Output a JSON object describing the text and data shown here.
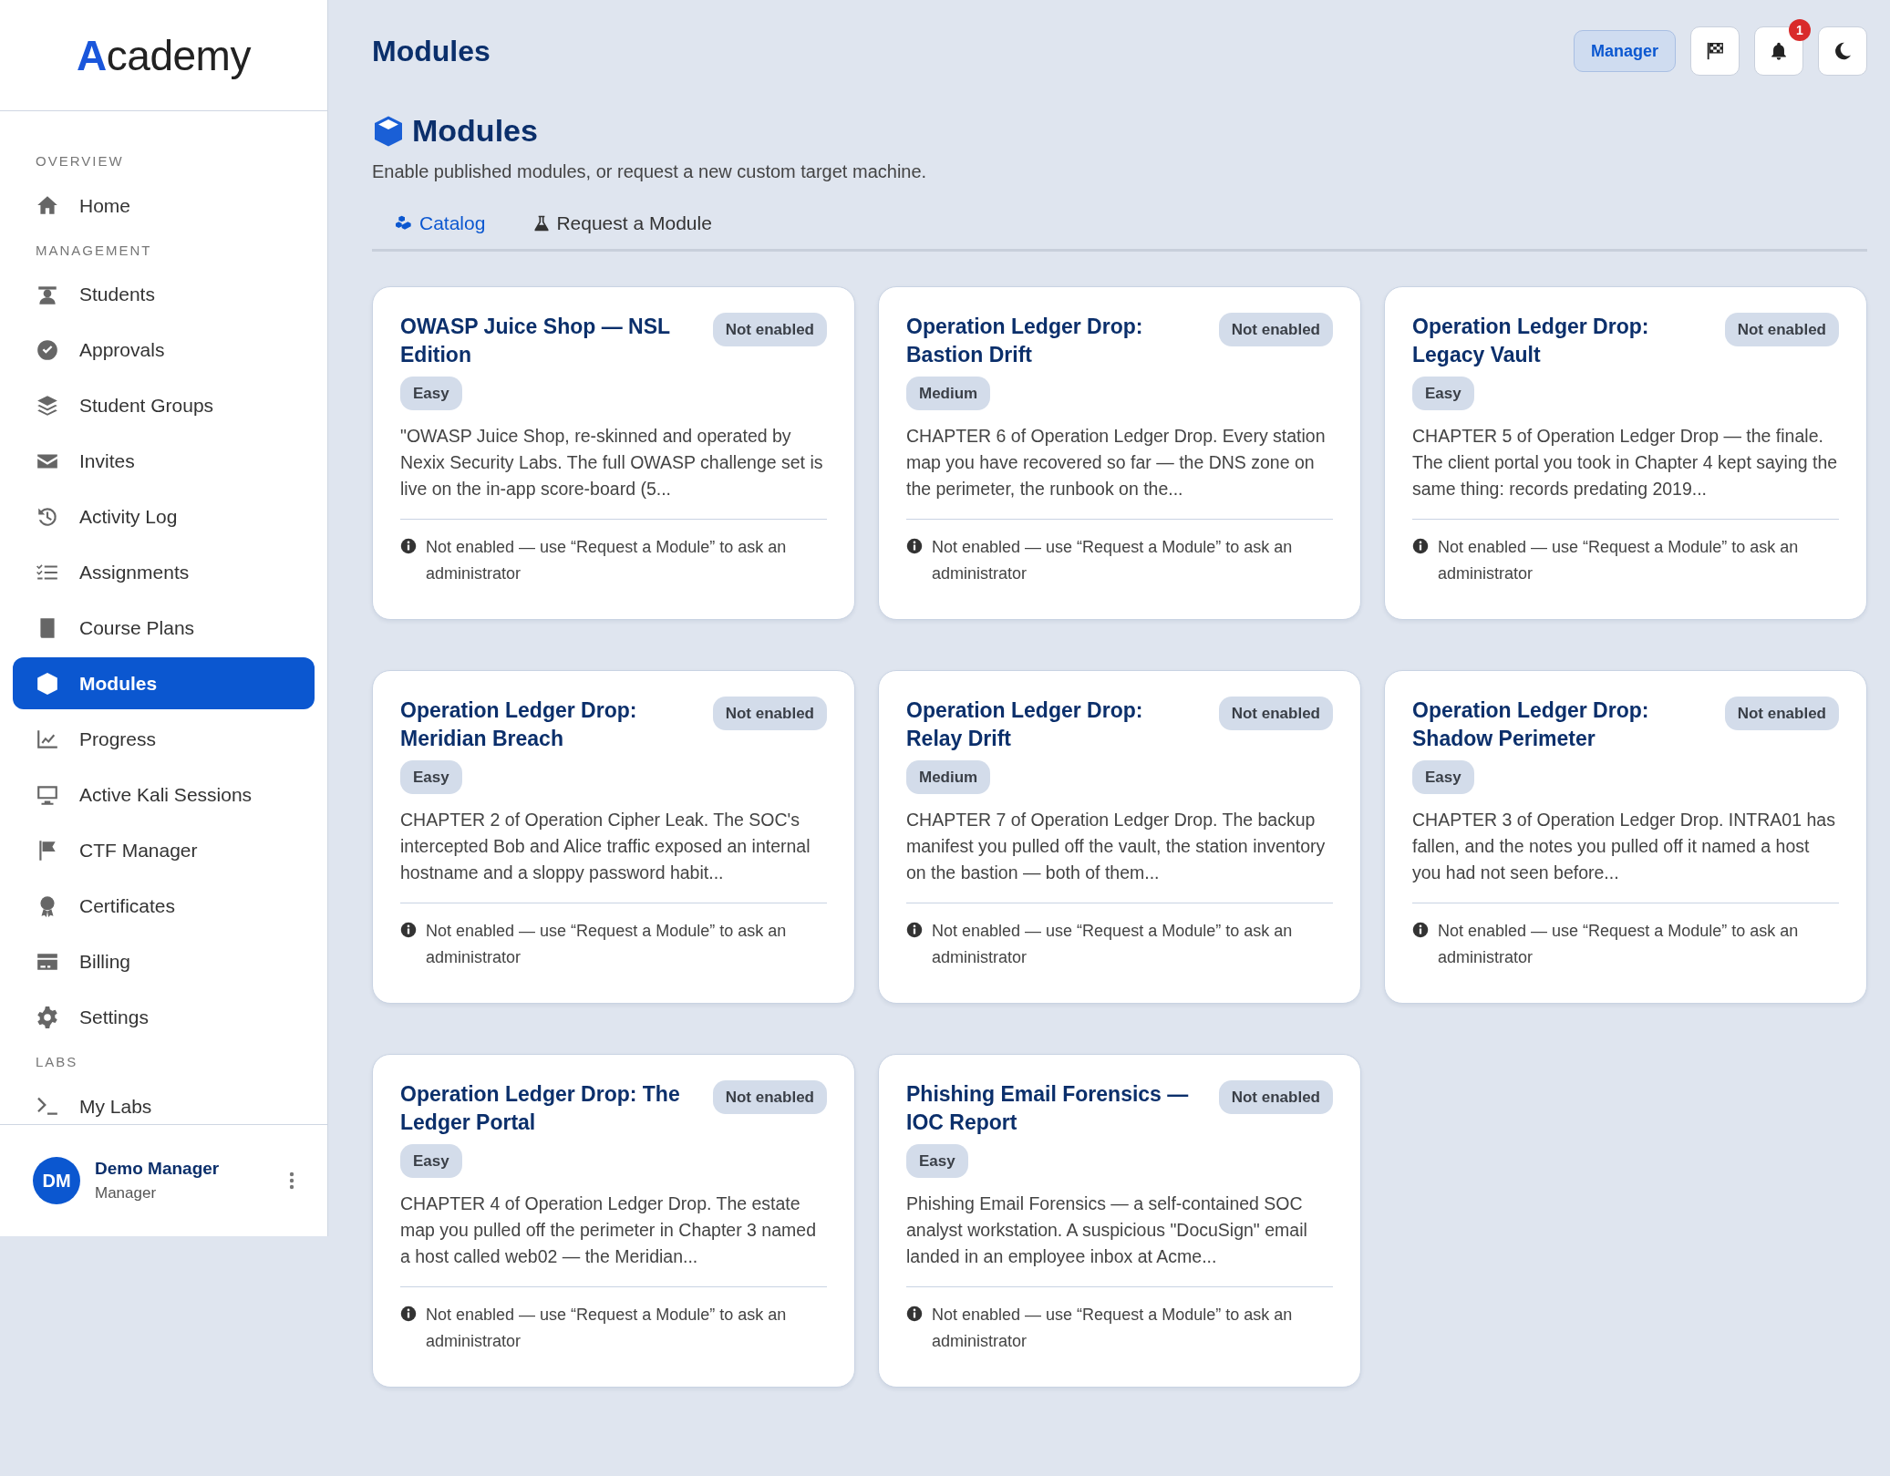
{
  "sidebar": {
    "logo": "Academy",
    "sections": [
      {
        "heading": "OVERVIEW",
        "items": [
          {
            "label": "Home",
            "selected": false
          }
        ]
      },
      {
        "heading": "MANAGEMENT",
        "items": [
          {
            "label": "Students",
            "selected": false
          },
          {
            "label": "Approvals",
            "selected": false
          },
          {
            "label": "Student Groups",
            "selected": false
          },
          {
            "label": "Invites",
            "selected": false
          },
          {
            "label": "Activity Log",
            "selected": false
          },
          {
            "label": "Assignments",
            "selected": false
          },
          {
            "label": "Course Plans",
            "selected": false
          },
          {
            "label": "Modules",
            "selected": true
          },
          {
            "label": "Progress",
            "selected": false
          },
          {
            "label": "Active Kali Sessions",
            "selected": false
          },
          {
            "label": "CTF Manager",
            "selected": false
          },
          {
            "label": "Certificates",
            "selected": false
          },
          {
            "label": "Billing",
            "selected": false
          },
          {
            "label": "Settings",
            "selected": false
          }
        ]
      },
      {
        "heading": "LABS",
        "items": [
          {
            "label": "My Labs",
            "selected": false
          }
        ]
      }
    ],
    "user": {
      "initials": "DM",
      "name": "Demo Manager",
      "role": "Manager"
    }
  },
  "topbar": {
    "title": "Modules",
    "role_button": "Manager",
    "notification_count": "1"
  },
  "page": {
    "title": "Modules",
    "subtitle": "Enable published modules, or request a new custom target machine.",
    "tabs": [
      {
        "label": "Catalog",
        "selected": true
      },
      {
        "label": "Request a Module",
        "selected": false
      }
    ],
    "cards": [
      {
        "title": "OWASP Juice Shop — NSL Edition",
        "status": "Not enabled",
        "difficulty": "Easy",
        "description": "\"OWASP Juice Shop, re-skinned and operated by Nexix Security Labs. The full OWASP challenge set is live on the in-app score-board (5...",
        "note": "Not enabled — use “Request a Module” to ask an administrator"
      },
      {
        "title": "Operation Ledger Drop: Bastion Drift",
        "status": "Not enabled",
        "difficulty": "Medium",
        "description": "CHAPTER 6 of Operation Ledger Drop. Every station map you have recovered so far — the DNS zone on the perimeter, the runbook on the...",
        "note": "Not enabled — use “Request a Module” to ask an administrator"
      },
      {
        "title": "Operation Ledger Drop: Legacy Vault",
        "status": "Not enabled",
        "difficulty": "Easy",
        "description": "CHAPTER 5 of Operation Ledger Drop — the finale. The client portal you took in Chapter 4 kept saying the same thing: records predating 2019...",
        "note": "Not enabled — use “Request a Module” to ask an administrator"
      },
      {
        "title": "Operation Ledger Drop: Meridian Breach",
        "status": "Not enabled",
        "difficulty": "Easy",
        "description": "CHAPTER 2 of Operation Cipher Leak. The SOC's intercepted Bob and Alice traffic exposed an internal hostname and a sloppy password habit...",
        "note": "Not enabled — use “Request a Module” to ask an administrator"
      },
      {
        "title": "Operation Ledger Drop: Relay Drift",
        "status": "Not enabled",
        "difficulty": "Medium",
        "description": "CHAPTER 7 of Operation Ledger Drop. The backup manifest you pulled off the vault, the station inventory on the bastion — both of them...",
        "note": "Not enabled — use “Request a Module” to ask an administrator"
      },
      {
        "title": "Operation Ledger Drop: Shadow Perimeter",
        "status": "Not enabled",
        "difficulty": "Easy",
        "description": "CHAPTER 3 of Operation Ledger Drop. INTRA01 has fallen, and the notes you pulled off it named a host you had not seen before...",
        "note": "Not enabled — use “Request a Module” to ask an administrator"
      },
      {
        "title": "Operation Ledger Drop: The Ledger Portal",
        "status": "Not enabled",
        "difficulty": "Easy",
        "description": "CHAPTER 4 of Operation Ledger Drop. The estate map you pulled off the perimeter in Chapter 3 named a host called web02 — the Meridian...",
        "note": "Not enabled — use “Request a Module” to ask an administrator"
      },
      {
        "title": "Phishing Email Forensics — IOC Report",
        "status": "Not enabled",
        "difficulty": "Easy",
        "description": "Phishing Email Forensics — a self-contained SOC analyst workstation. A suspicious \"DocuSign\" email landed in an employee inbox at Acme...",
        "note": "Not enabled — use “Request a Module” to ask an administrator"
      }
    ]
  }
}
